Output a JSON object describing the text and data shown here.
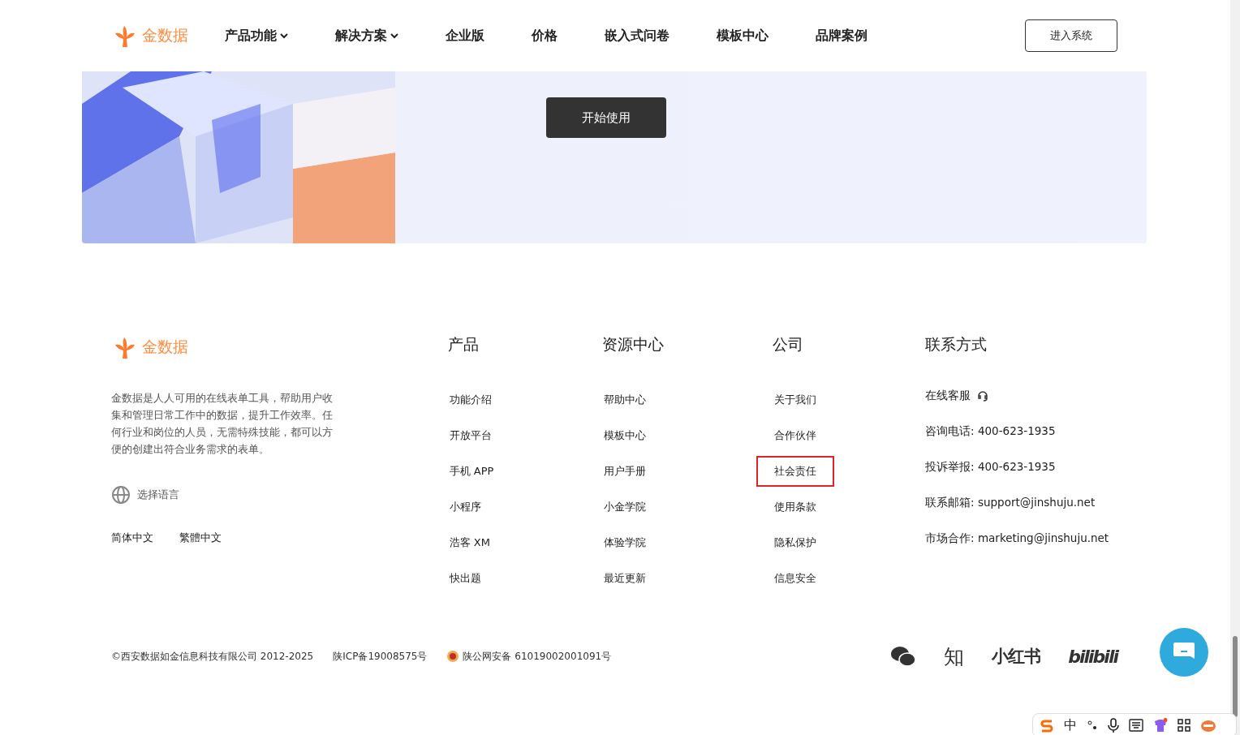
{
  "header": {
    "brand": "金数据",
    "nav": [
      {
        "label": "产品功能",
        "dropdown": true
      },
      {
        "label": "解决方案",
        "dropdown": true
      },
      {
        "label": "企业版",
        "dropdown": false
      },
      {
        "label": "价格",
        "dropdown": false
      },
      {
        "label": "嵌入式问卷",
        "dropdown": false
      },
      {
        "label": "模板中心",
        "dropdown": false
      },
      {
        "label": "品牌案例",
        "dropdown": false
      }
    ],
    "login_button": "进入系统"
  },
  "banner": {
    "kind": "picture",
    "button": "开始使用"
  },
  "footer": {
    "brand": "金数据",
    "description": "金数据是人人可用的在线表单工具，帮助用户收集和管理日常工作中的数据，提升工作效率。任何行业和岗位的人员，无需特殊技能，都可以方便的创建出符合业务需求的表单。",
    "language_label": "选择语言",
    "languages": [
      "简体中文",
      "繁體中文"
    ],
    "columns": [
      {
        "title": "产品",
        "links": [
          {
            "label": "功能介绍",
            "highlighted": false
          },
          {
            "label": "开放平台",
            "highlighted": false
          },
          {
            "label": "手机 APP",
            "highlighted": false
          },
          {
            "label": "小程序",
            "highlighted": false
          },
          {
            "label": "浩客 XM",
            "highlighted": false
          },
          {
            "label": "快出题",
            "highlighted": false
          }
        ]
      },
      {
        "title": "资源中心",
        "links": [
          {
            "label": "帮助中心",
            "highlighted": false
          },
          {
            "label": "模板中心",
            "highlighted": false
          },
          {
            "label": "用户手册",
            "highlighted": false
          },
          {
            "label": "小金学院",
            "highlighted": false
          },
          {
            "label": "体验学院",
            "highlighted": false
          },
          {
            "label": "最近更新",
            "highlighted": false
          }
        ]
      },
      {
        "title": "公司",
        "links": [
          {
            "label": "关于我们",
            "highlighted": false
          },
          {
            "label": "合作伙伴",
            "highlighted": false
          },
          {
            "label": "社会责任",
            "highlighted": true
          },
          {
            "label": "使用条款",
            "highlighted": false
          },
          {
            "label": "隐私保护",
            "highlighted": false
          },
          {
            "label": "信息安全",
            "highlighted": false
          }
        ]
      }
    ],
    "contact": {
      "title": "联系方式",
      "service": "在线客服",
      "lines": [
        "咨询电话: 400-623-1935",
        "投诉举报: 400-623-1935",
        "联系邮箱: support@jinshuju.net",
        "市场合作: marketing@jinshuju.net"
      ]
    },
    "copyright": "©西安数据如金信息科技有限公司 2012-2025",
    "icp": "陕ICP备19008575号",
    "police": "陕公网安备 61019002001091号",
    "social": [
      "知",
      "小红书",
      "bilibili"
    ]
  },
  "ime_toolbar": {
    "mode": "中"
  }
}
